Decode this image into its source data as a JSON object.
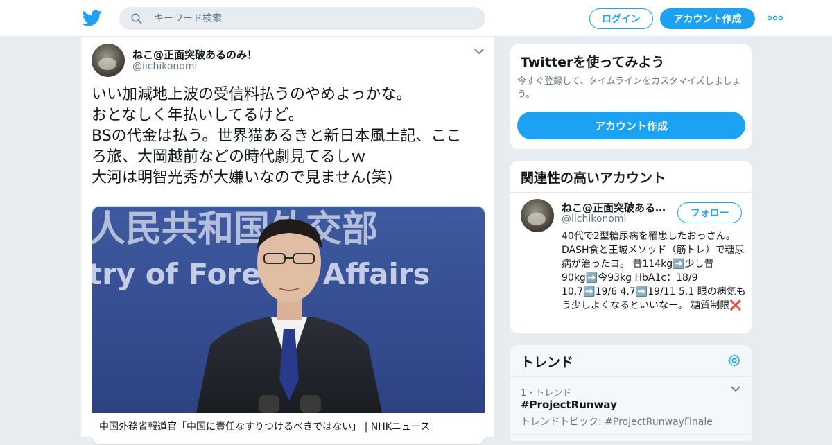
{
  "header": {
    "logo_icon": "twitter-bird-icon",
    "search_placeholder": "キーワード検索",
    "login_label": "ログイン",
    "signup_label": "アカウント作成",
    "more_icon": "more-dots-icon",
    "accent_color": "#1da1f2"
  },
  "tweet": {
    "display_name": "ねこ@正面突破あるのみ！",
    "handle": "@iichikonomi",
    "text_lines": [
      "いい加減地上波の受信料払うのやめよっかな。",
      "おとなしく年払いしてるけど。",
      "BSの代金は払う。世界猫あるきと新日本風土記、ここ",
      "ろ旅、大岡越前などの時代劇見てるしｗ",
      "大河は明智光秀が大嫌いなので見ません(笑)"
    ],
    "card_title": "中国外務省報道官「中国に責任なすりつけるべきではない」 | NHKニュース",
    "card_image_text": [
      "人民共和国外交部",
      "try of Foreign Affairs"
    ]
  },
  "signup_panel": {
    "title": "Twitterを使ってみよう",
    "subtitle": "今すぐ登録して、タイムラインをカスタマイズしましょう。",
    "button_label": "アカウント作成"
  },
  "related_panel": {
    "title": "関連性の高いアカウント",
    "name": "ねこ@正面突破あるのみ！",
    "handle": "@iichikonomi",
    "follow_label": "フォロー",
    "bio": "40代で2型糖尿病を罹患したおっさん。 DASH食と王城メソッド（筋トレ）で糖尿病が治ったヨ。 昔114kg➡️少し昔90kg➡️今93kg HbA1c：18/9 10.7➡️19/6 4.7➡️19/11 5.1 眼の病気もう少しよくなるといいなー。 糖質制限❌"
  },
  "trends_panel": {
    "title": "トレンド",
    "gear_icon": "gear-icon",
    "items": [
      {
        "rank": "1・トレンド",
        "name": "#ProjectRunway",
        "topic": "トレンドトピック: #ProjectRunwayFinale"
      }
    ]
  }
}
